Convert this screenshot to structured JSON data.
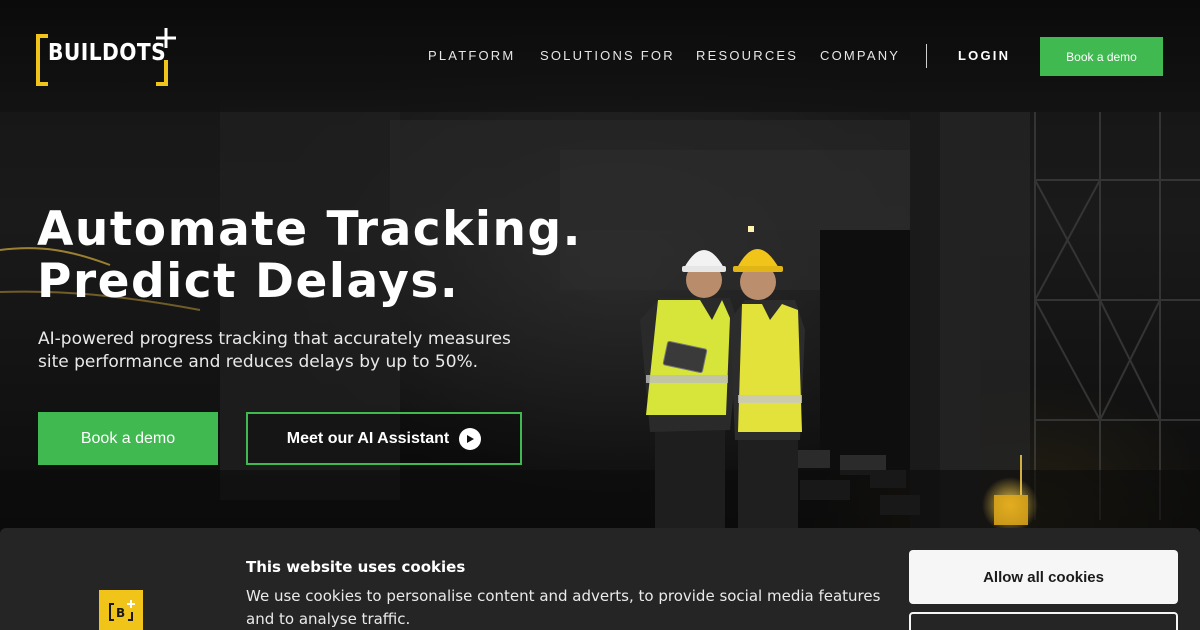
{
  "brand": {
    "name": "BUILDOTS",
    "accent_color": "#3fb950",
    "logo_color": "#f0c419"
  },
  "nav": {
    "items": [
      {
        "label": "PLATFORM"
      },
      {
        "label": "SOLUTIONS FOR"
      },
      {
        "label": "RESOURCES"
      },
      {
        "label": "COMPANY"
      }
    ],
    "login_label": "LOGIN",
    "cta_label": "Book a demo"
  },
  "hero": {
    "headline_line1": "Automate Tracking.",
    "headline_line2": "Predict Delays.",
    "subtext": "AI-powered progress tracking that accurately measures site performance and reduces delays by up to 50%.",
    "primary_button": "Book a demo",
    "secondary_button": "Meet our AI Assistant",
    "secondary_icon": "play-icon",
    "badge_letter": "B"
  },
  "cookie_banner": {
    "title": "This website uses cookies",
    "text": "We use cookies to personalise content and adverts, to provide social media features and to analyse traffic.",
    "allow_all_label": "Allow all cookies",
    "logo_letter": "B"
  }
}
